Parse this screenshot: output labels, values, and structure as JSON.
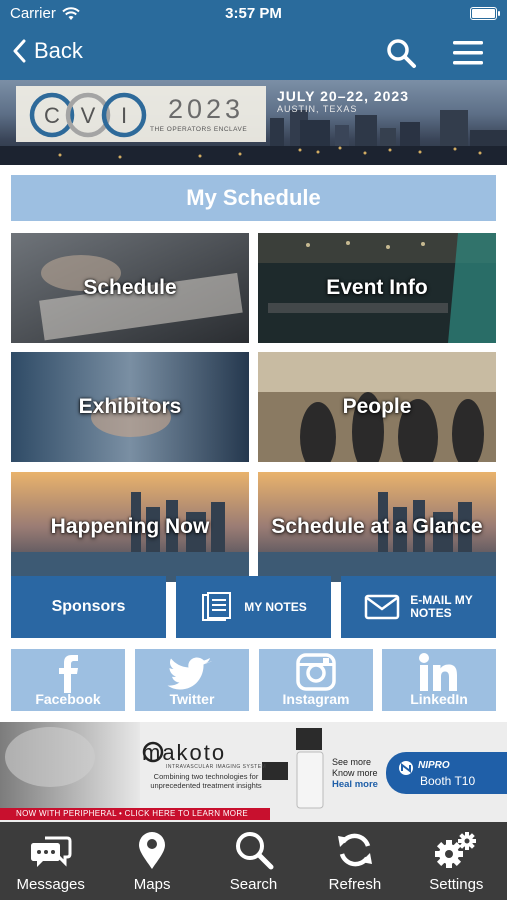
{
  "status_bar": {
    "carrier": "Carrier",
    "time": "3:57 PM"
  },
  "nav": {
    "back_label": "Back"
  },
  "banner": {
    "logo_letters": [
      "C",
      "V",
      "I"
    ],
    "year": "2023",
    "tagline": "THE OPERATORS ENCLAVE",
    "dates": "JULY 20–22, 2023",
    "location": "AUSTIN, TEXAS"
  },
  "my_schedule": "My Schedule",
  "tiles": [
    {
      "label": "Schedule"
    },
    {
      "label": "Event Info"
    },
    {
      "label": "Exhibitors"
    },
    {
      "label": "People"
    },
    {
      "label": "Happening Now"
    },
    {
      "label": "Schedule at a Glance"
    }
  ],
  "buttons": {
    "sponsors": "Sponsors",
    "my_notes": "MY NOTES",
    "email_notes_line1": "E-MAIL MY",
    "email_notes_line2": "NOTES"
  },
  "social": [
    {
      "label": "Facebook",
      "icon": "facebook-icon"
    },
    {
      "label": "Twitter",
      "icon": "twitter-icon"
    },
    {
      "label": "Instagram",
      "icon": "instagram-icon"
    },
    {
      "label": "LinkedIn",
      "icon": "linkedin-icon"
    }
  ],
  "ad": {
    "brand": "makoto",
    "brand_sub": "INTRAVASCULAR IMAGING SYSTEM",
    "combining": "Combining two technologies for unprecedented treatment insights",
    "see_more": "See more",
    "know_more": "Know more",
    "heal_more": "Heal more",
    "sponsor": "NIPRO",
    "booth": "Booth T10",
    "strip": "NOW WITH PERIPHERAL  •  CLICK HERE TO LEARN MORE"
  },
  "tab_bar": [
    {
      "label": "Messages",
      "icon": "messages-icon"
    },
    {
      "label": "Maps",
      "icon": "map-pin-icon"
    },
    {
      "label": "Search",
      "icon": "search-icon"
    },
    {
      "label": "Refresh",
      "icon": "refresh-icon"
    },
    {
      "label": "Settings",
      "icon": "gears-icon"
    }
  ],
  "colors": {
    "primary": "#2a6b9c",
    "button_blue": "#2a67a3",
    "light_blue": "#9dbfe1",
    "tab_bar": "#3c3c3c"
  }
}
